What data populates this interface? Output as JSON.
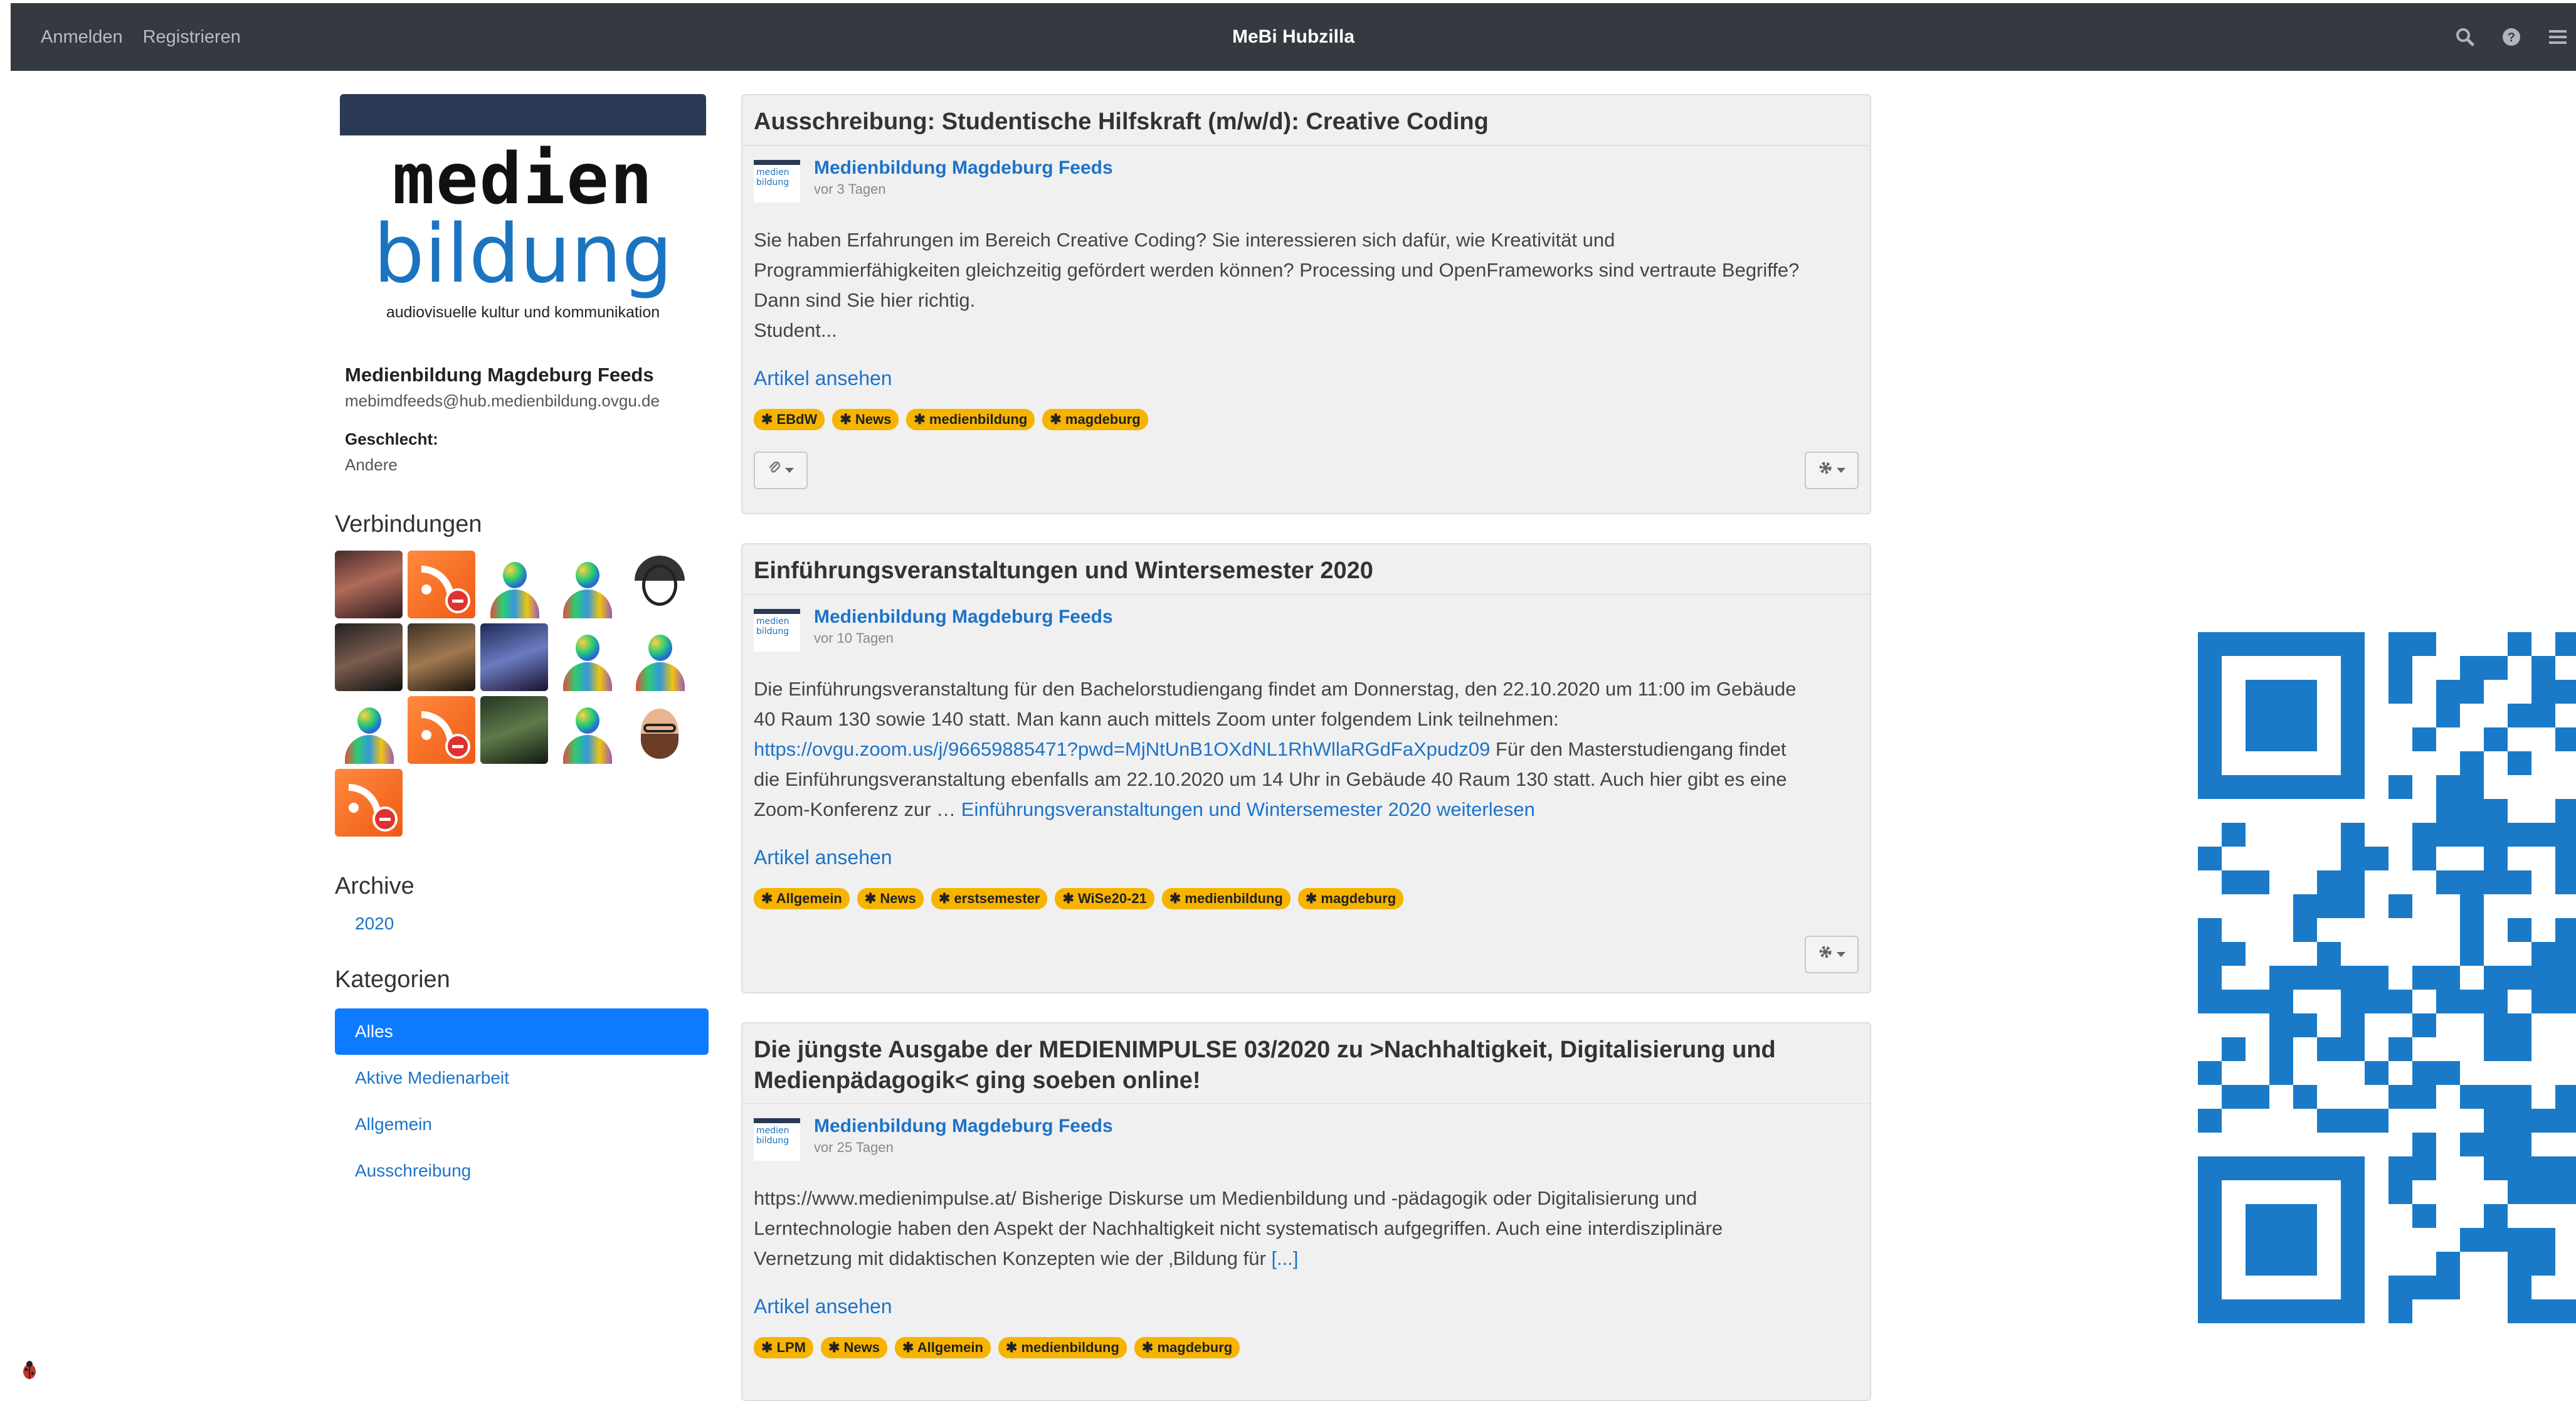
{
  "navbar": {
    "login": "Anmelden",
    "register": "Registrieren",
    "brand": "MeBi Hubzilla",
    "icons": [
      "search-icon",
      "help-icon",
      "menu-icon"
    ]
  },
  "profile": {
    "logo_line1": "medien",
    "logo_line2": "bildung",
    "logo_sub": "audiovisuelle kultur und kommunikation",
    "name": "Medienbildung Magdeburg Feeds",
    "address": "mebimdfeeds@hub.medienbildung.ovgu.de",
    "gender_label": "Geschlecht:",
    "gender_value": "Andere"
  },
  "connections": {
    "title": "Verbindungen",
    "avatars": [
      "photo",
      "rss",
      "default",
      "default",
      "sketch",
      "photo",
      "photo",
      "photo",
      "default",
      "default",
      "default",
      "rss",
      "photo",
      "default",
      "cartoon",
      "rss"
    ]
  },
  "archive": {
    "title": "Archive",
    "year": "2020"
  },
  "categories": {
    "title": "Kategorien",
    "items": [
      "Alles",
      "Aktive Medienarbeit",
      "Allgemein",
      "Ausschreibung"
    ]
  },
  "posts": [
    {
      "title": "Ausschreibung: Studentische Hilfskraft (m/w/d): Creative Coding",
      "author": "Medienbildung Magdeburg Feeds",
      "ago": "vor 3 Tagen",
      "body_lines": [
        "Sie haben Erfahrungen im Bereich Creative Coding? Sie interessieren sich dafür, wie Kreativität und",
        "Programmierfähigkeiten gleichzeitig gefördert werden können? Processing und OpenFrameworks sind vertraute Begriffe?",
        "Dann sind Sie hier richtig.",
        "Student..."
      ],
      "read_more": "Artikel ansehen",
      "tags": [
        "EBdW",
        "News",
        "medienbildung",
        "magdeburg"
      ]
    },
    {
      "title": "Einführungsveranstaltungen und Wintersemester 2020",
      "author": "Medienbildung Magdeburg Feeds",
      "ago": "vor 10 Tagen",
      "body_line1": "Die Einführungsveranstaltung für den Bachelorstudiengang findet am Donnerstag, den 22.10.2020 um 11:00 im Gebäude",
      "body_line2": "40 Raum 130 sowie 140 statt. Man kann auch mittels Zoom unter folgendem Link teilnehmen:",
      "body_link": "https://ovgu.zoom.us/j/96659885471?pwd=MjNtUnB1OXdNL1RhWllaRGdFaXpudz09",
      "body_line3_rest": " Für den Masterstudiengang findet",
      "body_line4": "die Einführungsveranstaltung ebenfalls am 22.10.2020 um 14 Uhr in Gebäude 40 Raum 130 statt. Auch hier gibt es eine",
      "body_line5": "Zoom-Konferenz zur … ",
      "continue_link": "Einführungsveranstaltungen und Wintersemester 2020 weiterlesen",
      "read_more": "Artikel ansehen",
      "tags": [
        "Allgemein",
        "News",
        "erstsemester",
        "WiSe20-21",
        "medienbildung",
        "magdeburg"
      ]
    },
    {
      "title_line1": "Die jüngste Ausgabe der MEDIENIMPULSE 03/2020 zu >Nachhaltigkeit, Digitalisierung und",
      "title_line2": "Medienpädagogik< ging soeben online!",
      "author": "Medienbildung Magdeburg Feeds",
      "ago": "vor 25 Tagen",
      "body_line1": "https://www.medienimpulse.at/ Bisherige Diskurse um Medienbildung und -pädagogik oder Digitalisierung und",
      "body_line2": "Lerntechnologie haben den Aspekt der Nachhaltigkeit nicht systematisch aufgegriffen. Auch eine interdisziplinäre",
      "body_line3": "Vernetzung mit didaktischen Konzepten wie der ‚Bildung für ",
      "more_link": "[...]",
      "read_more": "Artikel ansehen",
      "tags": [
        "LPM",
        "News",
        "Allgemein",
        "medienbildung",
        "magdeburg"
      ]
    }
  ],
  "colors": {
    "navbar": "#343a40",
    "accent": "#1d73c9",
    "active_category": "#0d7bff",
    "tag": "#f6b400",
    "qr": "#1a7ac7"
  }
}
